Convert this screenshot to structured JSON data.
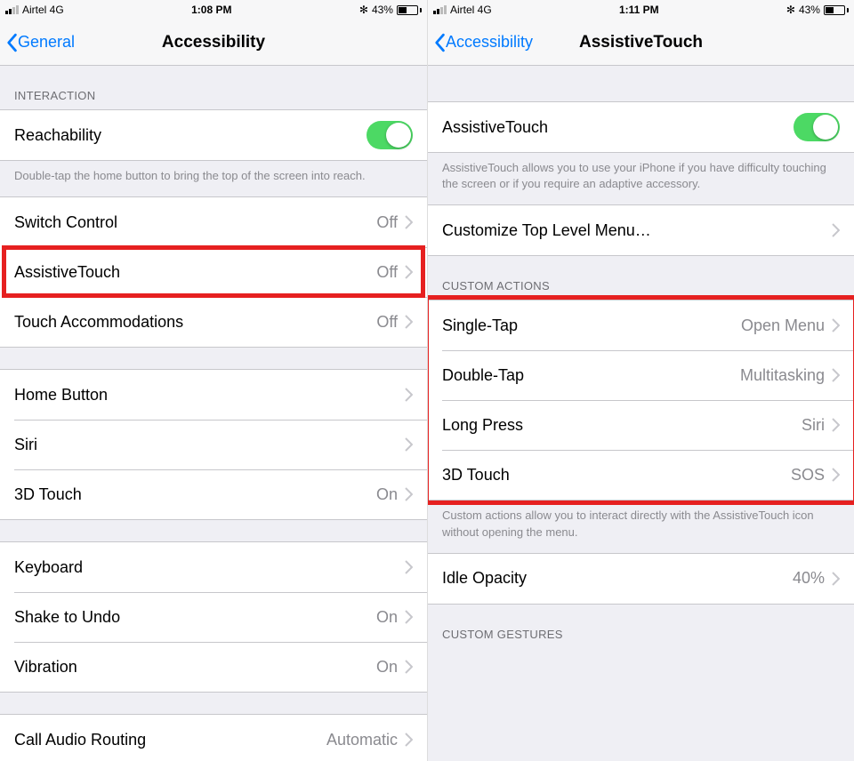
{
  "left": {
    "status": {
      "carrier": "Airtel  4G",
      "time": "1:08 PM",
      "battery": "43%",
      "bt": "✻"
    },
    "nav": {
      "back": "General",
      "title": "Accessibility"
    },
    "section_interaction": "INTERACTION",
    "reachability": {
      "label": "Reachability"
    },
    "reachability_footer": "Double-tap the home button to bring the top of the screen into reach.",
    "rows": {
      "switch_control": {
        "label": "Switch Control",
        "value": "Off"
      },
      "assistivetouch": {
        "label": "AssistiveTouch",
        "value": "Off"
      },
      "touch_accom": {
        "label": "Touch Accommodations",
        "value": "Off"
      },
      "home_button": {
        "label": "Home Button",
        "value": ""
      },
      "siri": {
        "label": "Siri",
        "value": ""
      },
      "three_d_touch": {
        "label": "3D Touch",
        "value": "On"
      },
      "keyboard": {
        "label": "Keyboard",
        "value": ""
      },
      "shake_undo": {
        "label": "Shake to Undo",
        "value": "On"
      },
      "vibration": {
        "label": "Vibration",
        "value": "On"
      },
      "call_audio": {
        "label": "Call Audio Routing",
        "value": "Automatic"
      }
    }
  },
  "right": {
    "status": {
      "carrier": "Airtel  4G",
      "time": "1:11 PM",
      "battery": "43%",
      "bt": "✻"
    },
    "nav": {
      "back": "Accessibility",
      "title": "AssistiveTouch"
    },
    "toggle": {
      "label": "AssistiveTouch"
    },
    "toggle_footer": "AssistiveTouch allows you to use your iPhone if you have difficulty touching the screen or if you require an adaptive accessory.",
    "customize": {
      "label": "Customize Top Level Menu…"
    },
    "section_custom_actions": "CUSTOM ACTIONS",
    "actions": {
      "single_tap": {
        "label": "Single-Tap",
        "value": "Open Menu"
      },
      "double_tap": {
        "label": "Double-Tap",
        "value": "Multitasking"
      },
      "long_press": {
        "label": "Long Press",
        "value": "Siri"
      },
      "three_d_touch": {
        "label": "3D Touch",
        "value": "SOS"
      }
    },
    "actions_footer": "Custom actions allow you to interact directly with the AssistiveTouch icon without opening the menu.",
    "idle_opacity": {
      "label": "Idle Opacity",
      "value": "40%"
    },
    "section_custom_gestures": "CUSTOM GESTURES"
  }
}
